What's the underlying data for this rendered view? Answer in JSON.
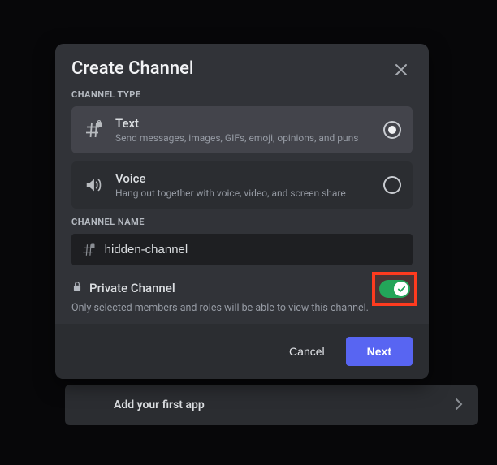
{
  "background": {
    "hint_text": "Add your first app"
  },
  "modal": {
    "title": "Create Channel",
    "close_icon": "×",
    "channel_type": {
      "label": "CHANNEL TYPE",
      "options": [
        {
          "id": "text",
          "title": "Text",
          "desc": "Send messages, images, GIFs, emoji, opinions, and puns",
          "selected": true
        },
        {
          "id": "voice",
          "title": "Voice",
          "desc": "Hang out together with voice, video, and screen share",
          "selected": false
        }
      ]
    },
    "channel_name": {
      "label": "CHANNEL NAME",
      "value": "hidden-channel"
    },
    "private": {
      "label": "Private Channel",
      "desc": "Only selected members and roles will be able to view this channel.",
      "enabled": true
    },
    "footer": {
      "cancel": "Cancel",
      "next": "Next"
    }
  },
  "colors": {
    "accent": "#5865f2",
    "toggle_on": "#23a559",
    "highlight": "#ff3b1f"
  }
}
